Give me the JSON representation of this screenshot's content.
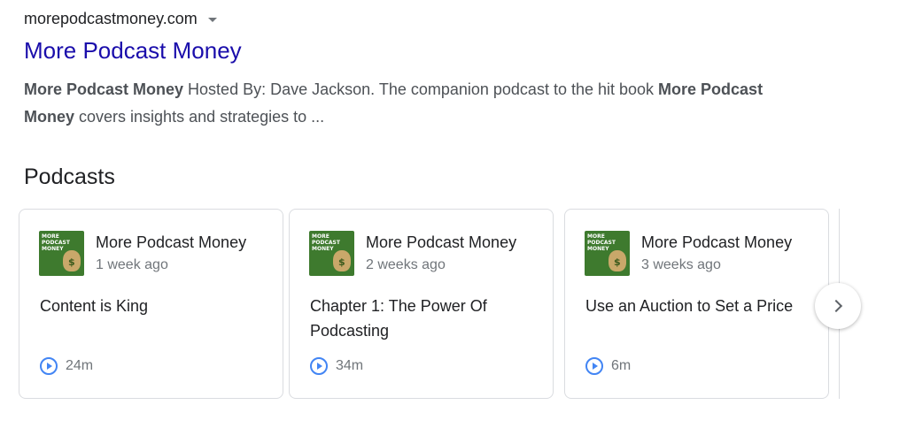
{
  "result": {
    "url": "morepodcastmoney.com",
    "title": "More Podcast Money",
    "snippet": {
      "p1": "More Podcast Money",
      "p2": " Hosted By: Dave Jackson. The companion podcast to the hit book ",
      "p3": "More Podcast Money",
      "p4": " covers insights and strategies to ..."
    }
  },
  "section": {
    "title": "Podcasts"
  },
  "thumbnail": {
    "line1": "MORE",
    "line2": "PODCAST",
    "line3": "MONEY",
    "symbol": "$"
  },
  "cards": [
    {
      "podcast": "More Podcast Money",
      "date": "1 week ago",
      "episode": "Content is King",
      "duration": "24m"
    },
    {
      "podcast": "More Podcast Money",
      "date": "2 weeks ago",
      "episode": "Chapter 1: The Power Of Podcasting",
      "duration": "34m"
    },
    {
      "podcast": "More Podcast Money",
      "date": "3 weeks ago",
      "episode": "Use an Auction to Set a Price",
      "duration": "6m"
    }
  ],
  "icons": {
    "play": "play-circle-icon",
    "next": "chevron-right-icon",
    "menu": "caret-down-icon"
  },
  "colors": {
    "link": "#1a0dab",
    "accent": "#4285f4",
    "muted": "#70757a"
  }
}
